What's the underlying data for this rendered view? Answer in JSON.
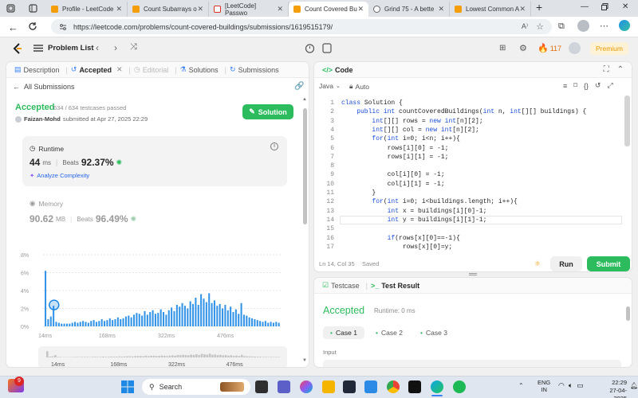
{
  "browser": {
    "tabs": [
      {
        "title": "Profile - LeetCode",
        "icon": "leetcode-icon"
      },
      {
        "title": "Count Subarrays o",
        "icon": "leetcode-icon"
      },
      {
        "title": "[LeetCode] Passwo",
        "icon": "gmail-icon"
      },
      {
        "title": "Count Covered Bu",
        "icon": "leetcode-icon"
      },
      {
        "title": "Grind 75 - A bette",
        "icon": "globe-icon"
      },
      {
        "title": "Lowest Common A",
        "icon": "leetcode-icon"
      }
    ],
    "url": "https://leetcode.com/problems/count-covered-buildings/submissions/1619515179/"
  },
  "header": {
    "problem_list": "Problem List",
    "streak": "117",
    "premium": "Premium"
  },
  "left_panel": {
    "tabs": [
      "Description",
      "Accepted",
      "Editorial",
      "Solutions",
      "Submissions"
    ],
    "all_submissions": "All Submissions",
    "status": "Accepted",
    "testcases": "634 / 634 testcases passed",
    "user": "Faizan-Mohd",
    "submitted_at": "submitted at Apr 27, 2025 22:29",
    "solution_button": "Solution",
    "runtime": {
      "label": "Runtime",
      "value": "44",
      "unit": "ms",
      "beats_label": "Beats",
      "beats": "92.37%",
      "analyze": "Analyze Complexity"
    },
    "memory": {
      "label": "Memory",
      "value": "90.62",
      "unit": "MB",
      "beats_label": "Beats",
      "beats": "96.49%"
    }
  },
  "chart_data": {
    "type": "bar",
    "ylim": [
      0,
      8
    ],
    "ytick_labels": [
      "8%",
      "6%",
      "4%",
      "2%",
      "0%"
    ],
    "xtick_labels": [
      "14ms",
      "168ms",
      "322ms",
      "476ms"
    ],
    "mini_xtick_labels": [
      "14ms",
      "168ms",
      "322ms",
      "476ms"
    ],
    "highlight_index": 3,
    "values": [
      6.2,
      0.8,
      1.1,
      2.3,
      0.5,
      0.4,
      0.3,
      0.3,
      0.3,
      0.3,
      0.4,
      0.5,
      0.4,
      0.5,
      0.6,
      0.5,
      0.4,
      0.6,
      0.7,
      0.5,
      0.6,
      0.8,
      0.6,
      0.7,
      0.9,
      0.7,
      0.8,
      1.0,
      0.8,
      0.9,
      1.1,
      1.2,
      1.0,
      1.3,
      1.5,
      1.4,
      1.2,
      1.7,
      1.3,
      1.6,
      1.8,
      1.4,
      1.5,
      1.9,
      1.6,
      1.3,
      1.8,
      2.1,
      1.7,
      2.4,
      2.2,
      2.6,
      2.3,
      2.0,
      2.8,
      2.5,
      3.2,
      2.4,
      3.6,
      3.1,
      2.7,
      3.7,
      2.6,
      2.9,
      2.3,
      2.5,
      2.0,
      2.4,
      1.8,
      2.2,
      1.6,
      1.9,
      1.4,
      2.6,
      1.3,
      1.2,
      1.0,
      0.9,
      0.8,
      0.7,
      0.6,
      0.5,
      0.6,
      0.4,
      0.5,
      0.4,
      0.5,
      0.4
    ]
  },
  "editor": {
    "title": "Code",
    "language": "Java",
    "mode": "Auto",
    "lines": [
      "class Solution {",
      "    public int countCoveredBuildings(int n, int[][] buildings) {",
      "        int[][] rows = new int[n][2];",
      "        int[][] col = new int[n][2];",
      "        for(int i=0; i<n; i++){",
      "            rows[i][0] = -1;",
      "            rows[i][1] = -1;",
      "",
      "            col[i][0] = -1;",
      "            col[i][1] = -1;",
      "        }",
      "        for(int i=0; i<buildings.length; i++){",
      "            int x = buildings[i][0]-1;",
      "            int y = buildings[i][1]-1;",
      "",
      "            if(rows[x][0]==-1){",
      "                rows[x][0]=y;"
    ],
    "status": "Ln 14, Col 35",
    "saved": "Saved",
    "run": "Run",
    "submit": "Submit"
  },
  "result_panel": {
    "tabs": [
      "Testcase",
      "Test Result"
    ],
    "status": "Accepted",
    "runtime": "Runtime: 0 ms",
    "cases": [
      "Case 1",
      "Case 2",
      "Case 3"
    ],
    "input_label": "Input"
  },
  "taskbar": {
    "search": "Search",
    "badge": "9",
    "lang_top": "ENG",
    "lang_bottom": "IN",
    "time": "22:29",
    "date": "27-04-2025"
  },
  "colors": {
    "accent_green": "#2cbb5d",
    "chart_blue": "#1e88e5",
    "editor_blue": "#1d4ed8"
  }
}
